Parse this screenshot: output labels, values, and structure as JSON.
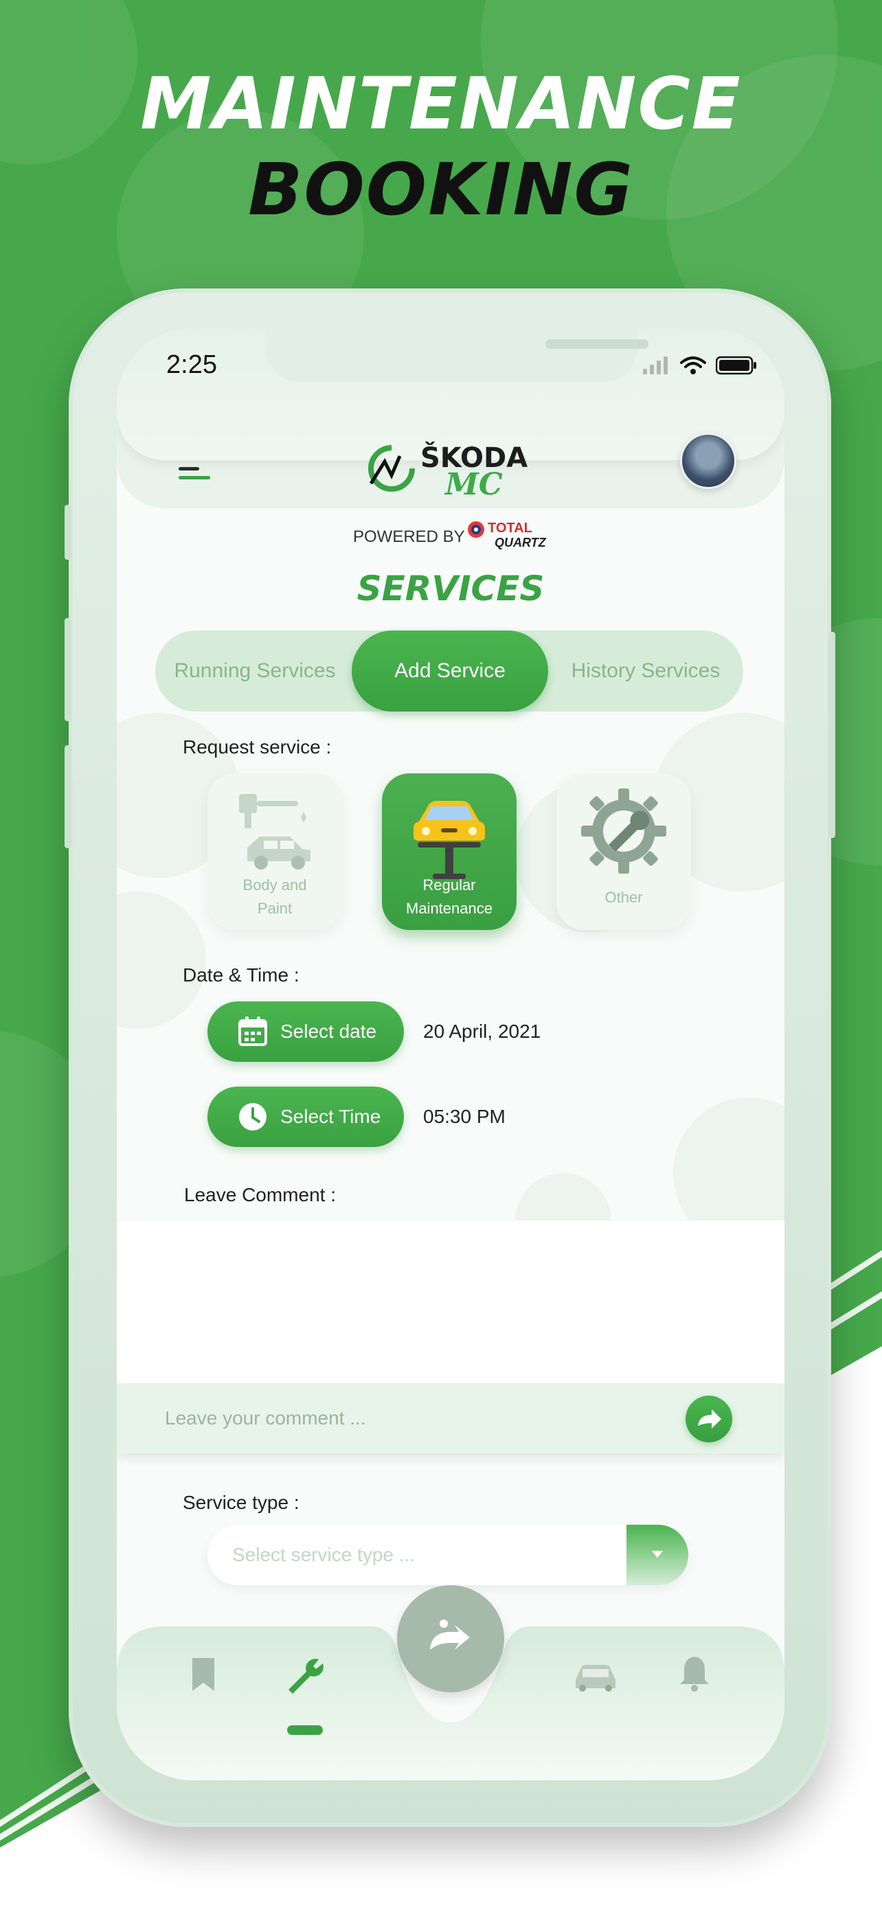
{
  "promo": {
    "headline_line1": "MAINTENANCE",
    "headline_line2": "BOOKING"
  },
  "status_bar": {
    "time": "2:25"
  },
  "header": {
    "logo_text": "ŠKODA",
    "logo_sub": "MC",
    "powered_by": "POWERED BY",
    "sponsor_top": "TOTAL",
    "sponsor_bottom": "QUARTZ"
  },
  "page_title": "SERVICES",
  "tabs": [
    {
      "label": "Running Services",
      "active": false
    },
    {
      "label": "Add Service",
      "active": true
    },
    {
      "label": "History Services",
      "active": false
    }
  ],
  "request_service": {
    "label": "Request service :",
    "options": [
      {
        "label_line1": "Body and",
        "label_line2": "Paint",
        "icon": "car-paint-icon",
        "selected": false
      },
      {
        "label_line1": "Regular",
        "label_line2": "Maintenance",
        "icon": "car-lift-icon",
        "selected": true
      },
      {
        "label_line1": "Other",
        "label_line2": "",
        "icon": "gear-wrench-icon",
        "selected": false
      }
    ]
  },
  "date_time": {
    "label": "Date & Time :",
    "date_button": "Select date",
    "date_value": "20 April, 2021",
    "time_button": "Select Time",
    "time_value": "05:30 PM"
  },
  "comment": {
    "label": "Leave Comment :",
    "placeholder": "Leave your comment ..."
  },
  "service_type": {
    "label": "Service type :",
    "placeholder": "Select service type ..."
  },
  "bottom_nav": {
    "items": [
      "bookmark-icon",
      "wrench-icon",
      "skoda-logo-icon",
      "car-icon",
      "bell-icon"
    ],
    "active": "wrench-icon"
  },
  "colors": {
    "brand_green": "#3aa344",
    "background_green": "#46a84b",
    "tab_bg": "#d6ecd9"
  }
}
